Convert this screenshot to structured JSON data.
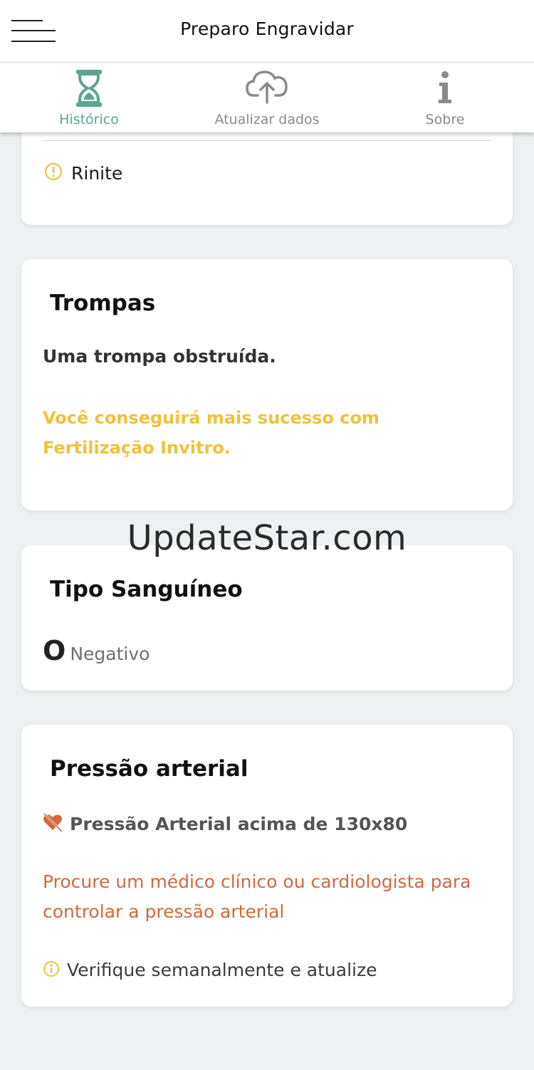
{
  "app": {
    "title": "Preparo Engravidar"
  },
  "tabs": [
    {
      "label": "Histórico",
      "icon": "hourglass-icon",
      "active": true
    },
    {
      "label": "Atualizar dados",
      "icon": "cloud-upload-icon",
      "active": false
    },
    {
      "label": "Sobre",
      "icon": "info-icon",
      "active": false
    }
  ],
  "allergies": {
    "item": "Rinite",
    "icon": "warning-circle-icon"
  },
  "tubes": {
    "title": "Trompas",
    "status": "Uma trompa obstruída.",
    "advice": "Você conseguirá mais sucesso com Fertilização Invitro."
  },
  "blood": {
    "title": "Tipo Sanguíneo",
    "type": "O",
    "rh": "Negativo"
  },
  "pressure": {
    "title": "Pressão arterial",
    "status": "Pressão Arterial acima de 130x80",
    "status_icon": "broken-heart-icon",
    "advice": "Procure um médico clínico ou cardiologista para controlar a pressão arterial",
    "check": "Verifique semanalmente e atualize",
    "check_icon": "info-circle-icon"
  },
  "watermark": "UpdateStar.com",
  "colors": {
    "accent": "#5aa592",
    "warning": "#f1c13c",
    "alert": "#d2693d",
    "muted": "#8a8a8a"
  }
}
